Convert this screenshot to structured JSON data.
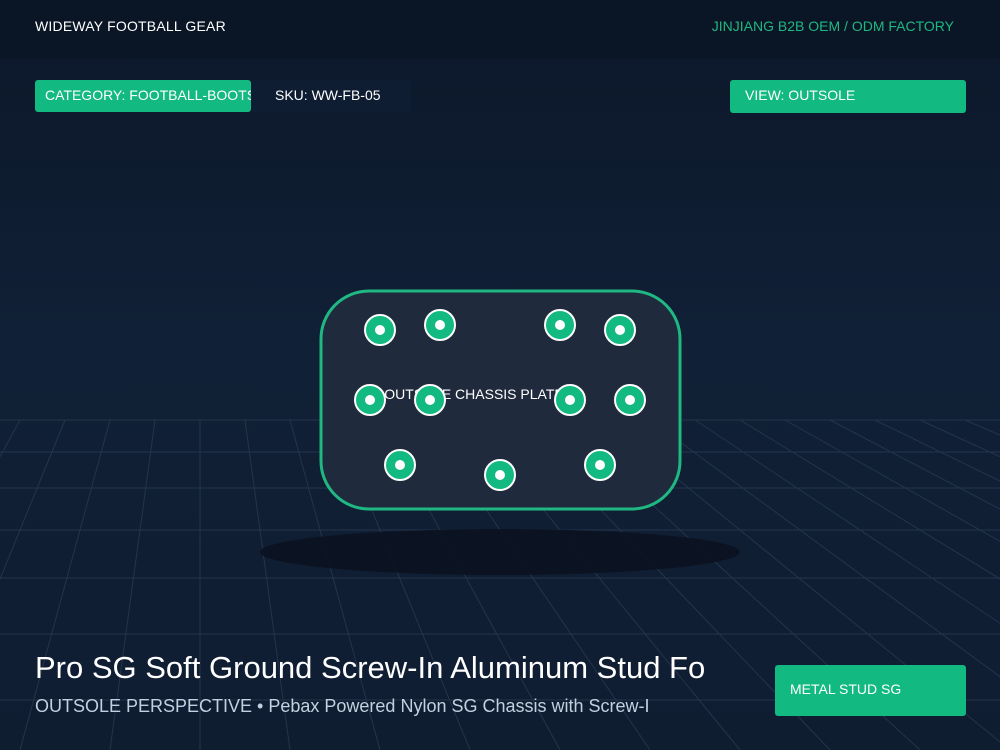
{
  "header": {
    "brand": "WIDEWAY FOOTBALL GEAR",
    "factory": "JINJIANG B2B OEM / ODM FACTORY"
  },
  "chips": {
    "category": "CATEGORY: FOOTBALL-BOOTS",
    "sku": "SKU: WW-FB-05",
    "view": "VIEW: OUTSOLE"
  },
  "scene": {
    "plate_label": "OUTSOLE CHASSIS PLATE",
    "stud_count": 11,
    "colors": {
      "accent": "#12b981",
      "plate_fill": "#1f2a3c",
      "plate_border": "#1fb882",
      "background": "#0f1b2e"
    }
  },
  "product": {
    "title": "Pro SG Soft Ground Screw-In Aluminum Stud Fo",
    "subtitle": "OUTSOLE PERSPECTIVE • Pebax Powered Nylon SG Chassis with Screw-I",
    "badge": "METAL STUD SG"
  }
}
